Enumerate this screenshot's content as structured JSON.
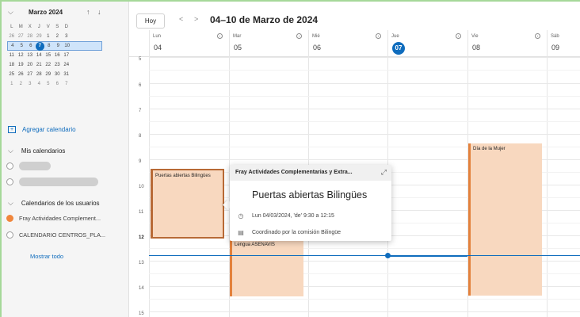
{
  "sidebar": {
    "mini_calendar": {
      "month_title": "Marzo 2024",
      "weekdays": [
        "L",
        "M",
        "X",
        "J",
        "V",
        "S",
        "D"
      ],
      "weeks": [
        [
          "26",
          "27",
          "28",
          "29",
          "1",
          "2",
          "3"
        ],
        [
          "4",
          "5",
          "6",
          "7",
          "8",
          "9",
          "10"
        ],
        [
          "11",
          "12",
          "13",
          "14",
          "15",
          "16",
          "17"
        ],
        [
          "18",
          "19",
          "20",
          "21",
          "22",
          "23",
          "24"
        ],
        [
          "25",
          "26",
          "27",
          "28",
          "29",
          "30",
          "31"
        ],
        [
          "1",
          "2",
          "3",
          "4",
          "5",
          "6",
          "7"
        ]
      ],
      "selected_week_index": 1,
      "today_day": "7"
    },
    "add_calendar_label": "Agregar calendario",
    "my_calendars": {
      "heading": "Mis calendarios"
    },
    "user_calendars": {
      "heading": "Calendarios de los usuarios",
      "items": [
        {
          "label": "Fray Actividades Complement...",
          "checked": true,
          "color": "#f0863c"
        },
        {
          "label": "CALENDARIO CENTROS_PLA...",
          "checked": false
        }
      ]
    },
    "show_all_label": "Mostrar todo"
  },
  "header": {
    "today_label": "Hoy",
    "prev_icon": "chevron-left-icon",
    "next_icon": "chevron-right-icon",
    "range_title": "04–10 de Marzo de 2024"
  },
  "days": [
    {
      "name": "Lun",
      "num": "04",
      "today": false
    },
    {
      "name": "Mar",
      "num": "05",
      "today": false
    },
    {
      "name": "Mié",
      "num": "06",
      "today": false
    },
    {
      "name": "Jue",
      "num": "07",
      "today": true
    },
    {
      "name": "Vie",
      "num": "08",
      "today": false
    },
    {
      "name": "Sáb",
      "num": "09",
      "today": false
    }
  ],
  "hours": [
    "5",
    "6",
    "7",
    "8",
    "9",
    "10",
    "11",
    "12",
    "13",
    "14",
    "15"
  ],
  "events": [
    {
      "title": "Puertas abiertas Bilingües",
      "day": "Lun",
      "selected": true
    },
    {
      "title": "Lengua ASENAVIS",
      "day": "Mar",
      "selected": false
    },
    {
      "title": "Día de la Mujer",
      "day": "Vie",
      "selected": false
    }
  ],
  "popup": {
    "calendar_name": "Fray Actividades Complementarias y Extra...",
    "title": "Puertas abiertas Bilingües",
    "time_text": "Lun 04/03/2024, 'de' 9:30 a 12:15",
    "description": "Coordinado por la comisión Bilingüe"
  },
  "colors": {
    "accent": "#0f6cbd",
    "event_fill": "#f8d8bf",
    "event_border": "#e3813c"
  }
}
